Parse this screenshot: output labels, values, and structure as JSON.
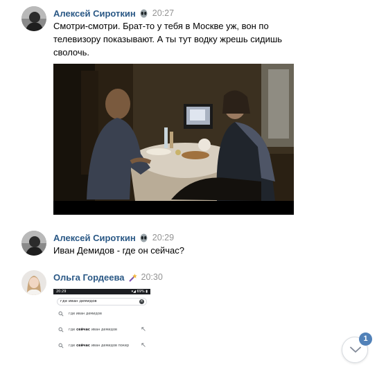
{
  "messages": [
    {
      "author": "Алексей Сироткин",
      "emoji": "alien-emoji",
      "time": "20:27",
      "lines": [
        "Смотри-смотри. Брат-то у тебя в Москве уж, вон по",
        "телевизору показывают. А ты тут водку жрешь сидишь",
        "сволочь."
      ],
      "attachment": "film-still-image"
    },
    {
      "author": "Алексей Сироткин",
      "emoji": "alien-emoji",
      "time": "20:29",
      "lines": [
        "Иван Демидов - где он сейчас?"
      ]
    },
    {
      "author": "Ольга Гордеева",
      "emoji": "magic-wand-emoji",
      "time": "20:30",
      "screenshot": {
        "status_time": "20:29",
        "status_right": "▾◢ 69% ▮",
        "query": "где иван демидов",
        "suggestions": [
          {
            "pre": "где иван демидов",
            "bold": "",
            "post": ""
          },
          {
            "pre": "где",
            "bold": "сейчас",
            "post": "иван демидов"
          },
          {
            "pre": "где",
            "bold": "сейчас",
            "post": "иван демидов покер"
          }
        ]
      }
    }
  ],
  "scroll_down": {
    "unread_count": "1"
  },
  "colors": {
    "author": "#2a5885",
    "time": "#939393",
    "badge": "#5181b8"
  }
}
